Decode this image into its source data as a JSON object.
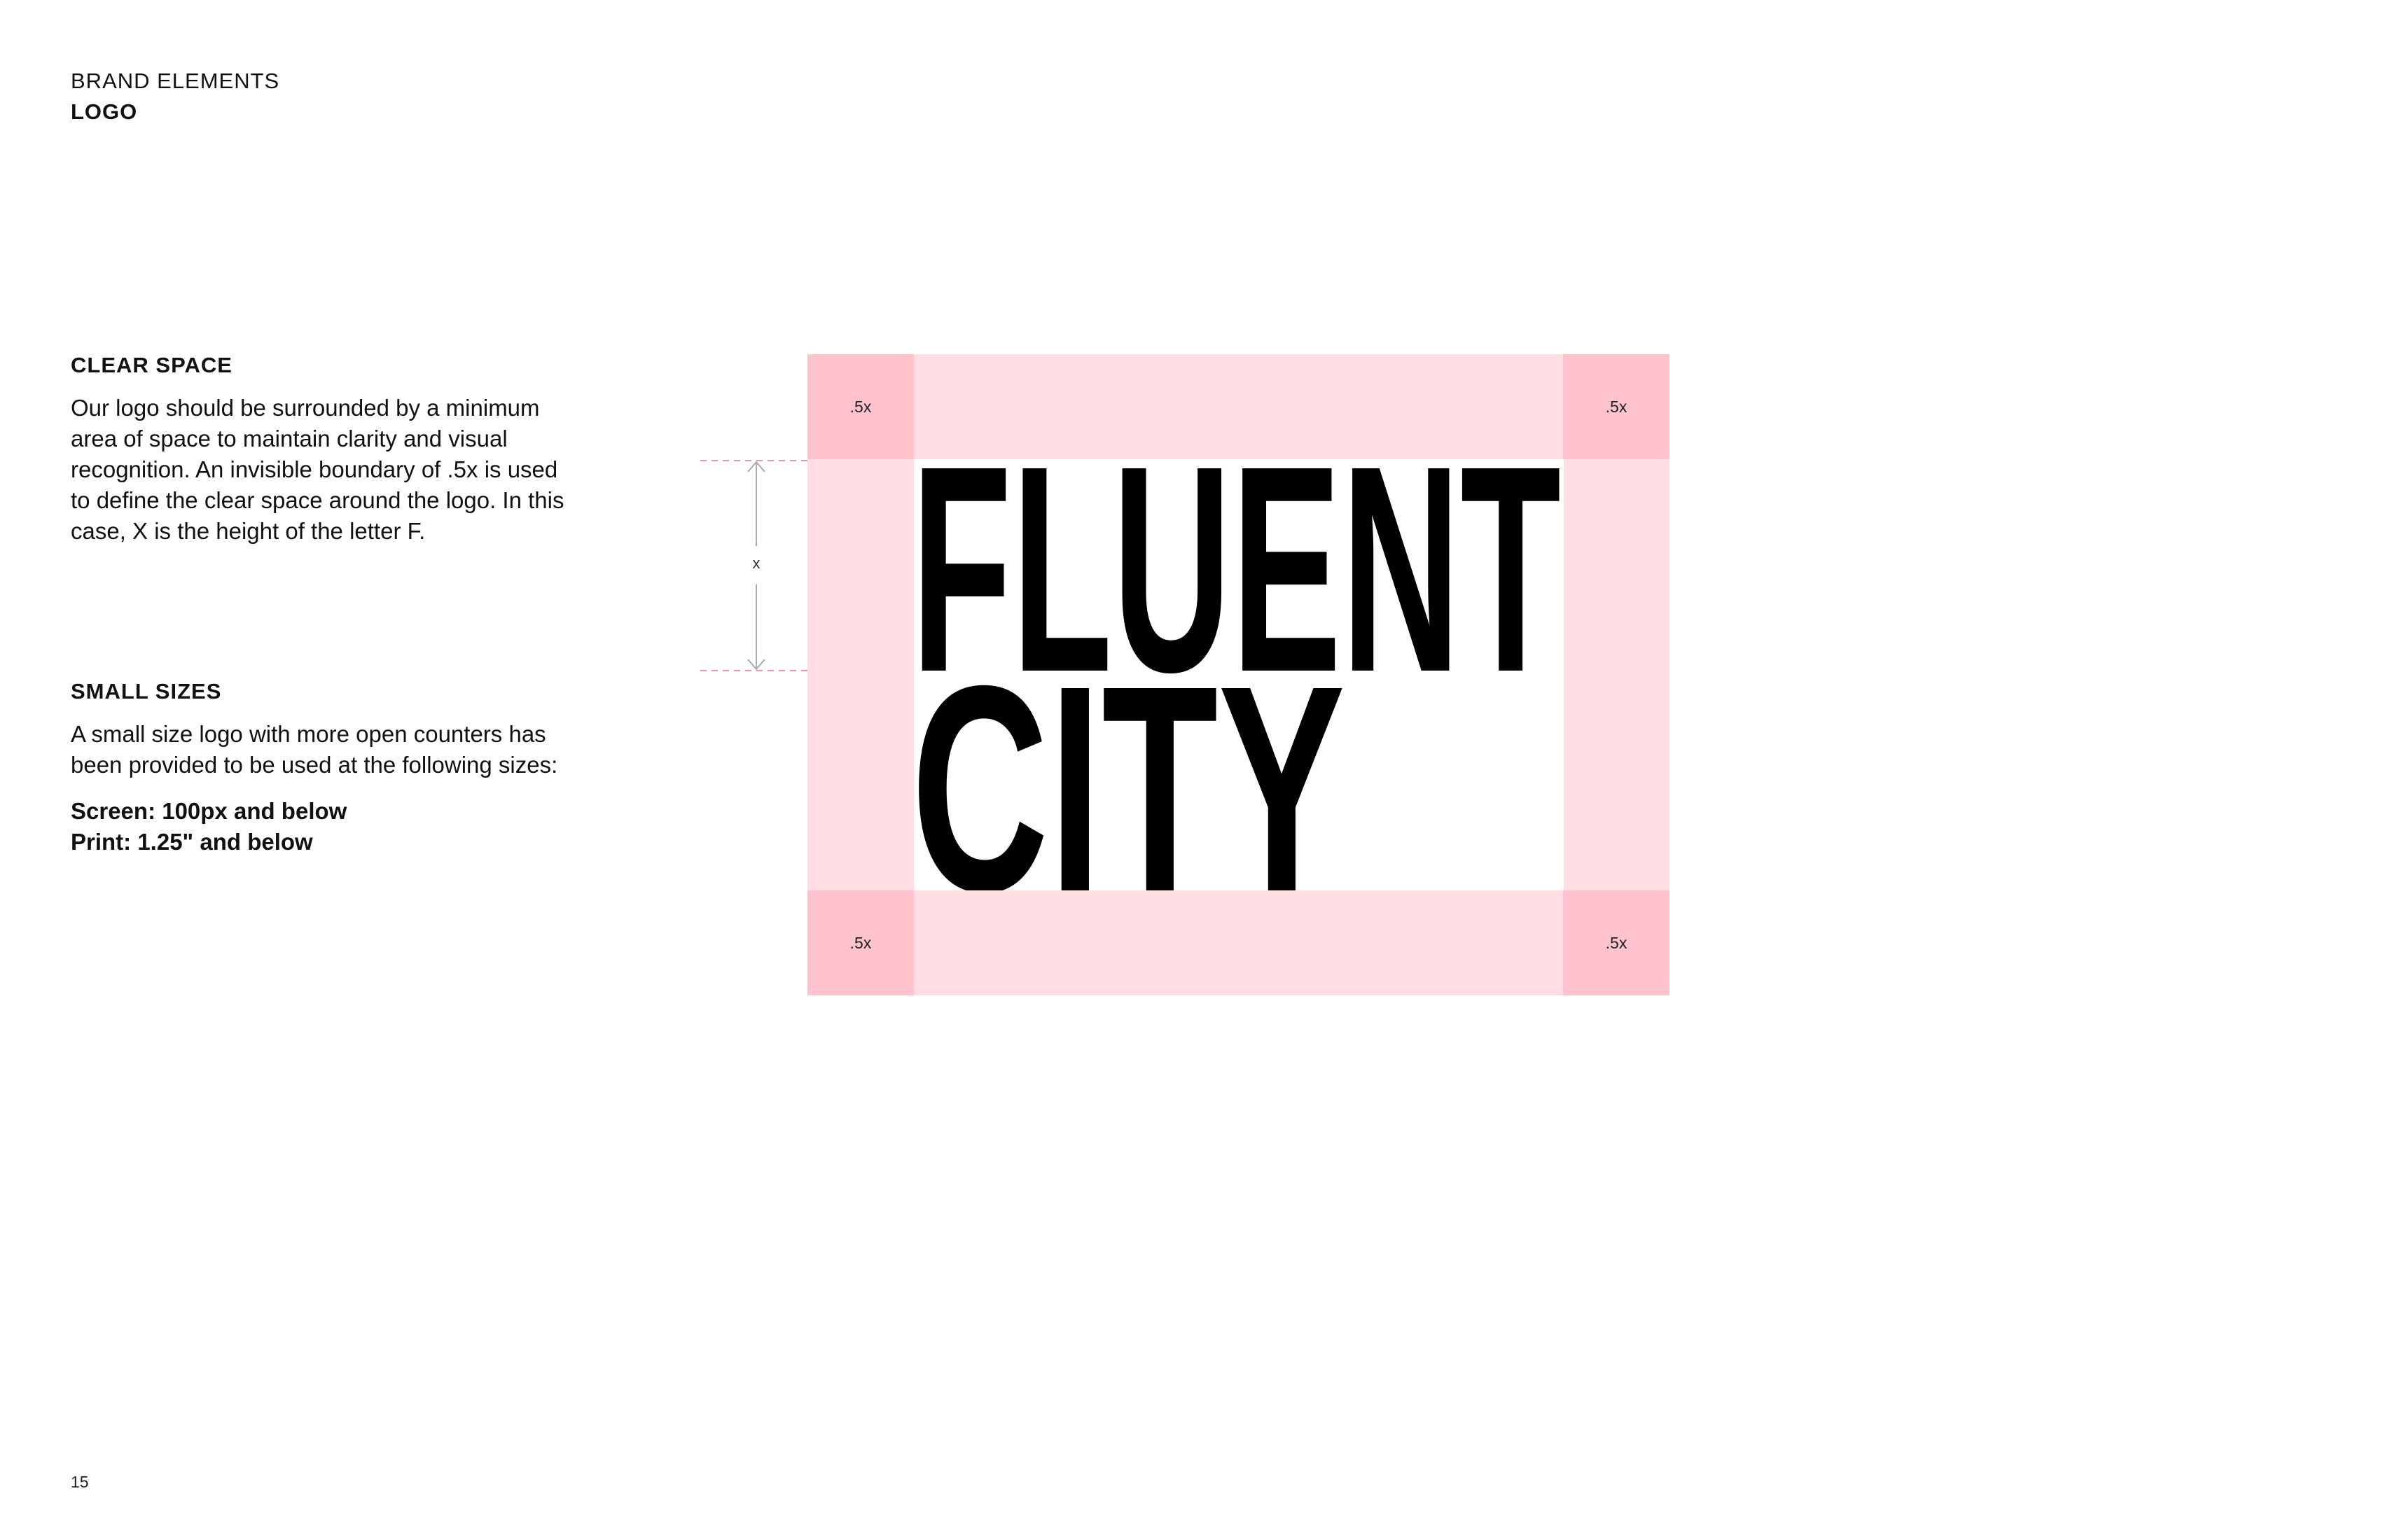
{
  "header": {
    "section": "BRAND ELEMENTS",
    "subsection": "LOGO"
  },
  "clear_space": {
    "title": "CLEAR SPACE",
    "body": "Our logo should be surrounded by a minimum\narea of space to maintain clarity and visual\nrecognition. An invisible boundary of .5x is used\nto define the clear space around the logo. In this\ncase, X is the height of the letter F."
  },
  "small_sizes": {
    "title": "SMALL SIZES",
    "body": "A small size logo with more open counters has\nbeen provided to be used at the following sizes:",
    "specs": "Screen: 100px and below\nPrint: 1.25\" and below"
  },
  "diagram": {
    "corner_labels": [
      ".5x",
      ".5x",
      ".5x",
      ".5x"
    ],
    "measure_label": "x",
    "logo_line_1": "FLUENT",
    "logo_line_2": "CITY",
    "colors": {
      "clear_space_fill": "#ffdde3",
      "corner_fill": "#fec3cd",
      "guide_line": "#e39aa6",
      "logo": "#000000"
    }
  },
  "footer": {
    "page_number": "15"
  }
}
